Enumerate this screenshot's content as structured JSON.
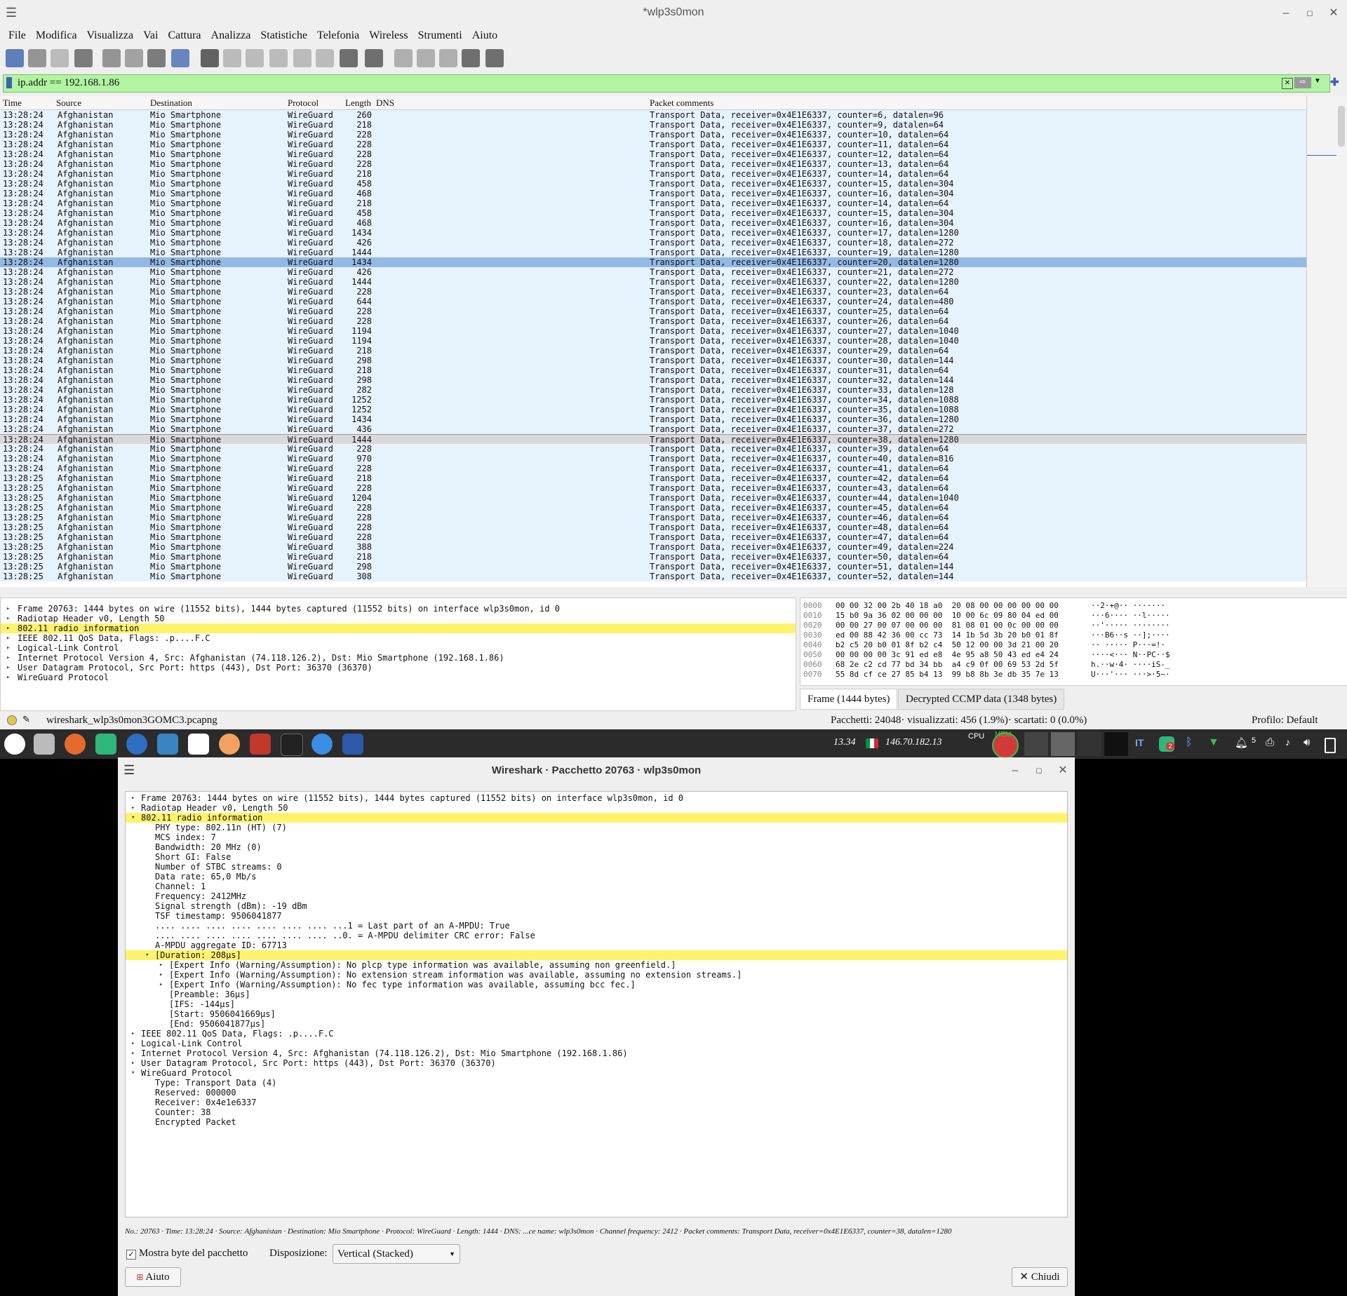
{
  "window": {
    "title": "*wlp3s0mon"
  },
  "menu": [
    "File",
    "Modifica",
    "Visualizza",
    "Vai",
    "Cattura",
    "Analizza",
    "Statistiche",
    "Telefonia",
    "Wireless",
    "Strumenti",
    "Aiuto"
  ],
  "filter": {
    "value": "ip.addr == 192.168.1.86"
  },
  "columns": {
    "time": "Time",
    "source": "Source",
    "destination": "Destination",
    "protocol": "Protocol",
    "length": "Length",
    "dns": "DNS",
    "comments": "Packet comments"
  },
  "packets": [
    {
      "t": "13:28:24",
      "src": "Afghanistan",
      "dst": "Mio Smartphone",
      "proto": "WireGuard",
      "len": "260",
      "info": "Transport Data, receiver=0x4E1E6337, counter=6, datalen=96"
    },
    {
      "t": "13:28:24",
      "src": "Afghanistan",
      "dst": "Mio Smartphone",
      "proto": "WireGuard",
      "len": "218",
      "info": "Transport Data, receiver=0x4E1E6337, counter=9, datalen=64"
    },
    {
      "t": "13:28:24",
      "src": "Afghanistan",
      "dst": "Mio Smartphone",
      "proto": "WireGuard",
      "len": "228",
      "info": "Transport Data, receiver=0x4E1E6337, counter=10, datalen=64"
    },
    {
      "t": "13:28:24",
      "src": "Afghanistan",
      "dst": "Mio Smartphone",
      "proto": "WireGuard",
      "len": "228",
      "info": "Transport Data, receiver=0x4E1E6337, counter=11, datalen=64"
    },
    {
      "t": "13:28:24",
      "src": "Afghanistan",
      "dst": "Mio Smartphone",
      "proto": "WireGuard",
      "len": "228",
      "info": "Transport Data, receiver=0x4E1E6337, counter=12, datalen=64"
    },
    {
      "t": "13:28:24",
      "src": "Afghanistan",
      "dst": "Mio Smartphone",
      "proto": "WireGuard",
      "len": "228",
      "info": "Transport Data, receiver=0x4E1E6337, counter=13, datalen=64"
    },
    {
      "t": "13:28:24",
      "src": "Afghanistan",
      "dst": "Mio Smartphone",
      "proto": "WireGuard",
      "len": "218",
      "info": "Transport Data, receiver=0x4E1E6337, counter=14, datalen=64"
    },
    {
      "t": "13:28:24",
      "src": "Afghanistan",
      "dst": "Mio Smartphone",
      "proto": "WireGuard",
      "len": "458",
      "info": "Transport Data, receiver=0x4E1E6337, counter=15, datalen=304"
    },
    {
      "t": "13:28:24",
      "src": "Afghanistan",
      "dst": "Mio Smartphone",
      "proto": "WireGuard",
      "len": "468",
      "info": "Transport Data, receiver=0x4E1E6337, counter=16, datalen=304"
    },
    {
      "t": "13:28:24",
      "src": "Afghanistan",
      "dst": "Mio Smartphone",
      "proto": "WireGuard",
      "len": "218",
      "info": "Transport Data, receiver=0x4E1E6337, counter=14, datalen=64"
    },
    {
      "t": "13:28:24",
      "src": "Afghanistan",
      "dst": "Mio Smartphone",
      "proto": "WireGuard",
      "len": "458",
      "info": "Transport Data, receiver=0x4E1E6337, counter=15, datalen=304"
    },
    {
      "t": "13:28:24",
      "src": "Afghanistan",
      "dst": "Mio Smartphone",
      "proto": "WireGuard",
      "len": "468",
      "info": "Transport Data, receiver=0x4E1E6337, counter=16, datalen=304"
    },
    {
      "t": "13:28:24",
      "src": "Afghanistan",
      "dst": "Mio Smartphone",
      "proto": "WireGuard",
      "len": "1434",
      "info": "Transport Data, receiver=0x4E1E6337, counter=17, datalen=1280"
    },
    {
      "t": "13:28:24",
      "src": "Afghanistan",
      "dst": "Mio Smartphone",
      "proto": "WireGuard",
      "len": "426",
      "info": "Transport Data, receiver=0x4E1E6337, counter=18, datalen=272"
    },
    {
      "t": "13:28:24",
      "src": "Afghanistan",
      "dst": "Mio Smartphone",
      "proto": "WireGuard",
      "len": "1444",
      "info": "Transport Data, receiver=0x4E1E6337, counter=19, datalen=1280"
    },
    {
      "t": "13:28:24",
      "src": "Afghanistan",
      "dst": "Mio Smartphone",
      "proto": "WireGuard",
      "len": "1434",
      "info": "Transport Data, receiver=0x4E1E6337, counter=20, datalen=1280",
      "state": "sel"
    },
    {
      "t": "13:28:24",
      "src": "Afghanistan",
      "dst": "Mio Smartphone",
      "proto": "WireGuard",
      "len": "426",
      "info": "Transport Data, receiver=0x4E1E6337, counter=21, datalen=272"
    },
    {
      "t": "13:28:24",
      "src": "Afghanistan",
      "dst": "Mio Smartphone",
      "proto": "WireGuard",
      "len": "1444",
      "info": "Transport Data, receiver=0x4E1E6337, counter=22, datalen=1280"
    },
    {
      "t": "13:28:24",
      "src": "Afghanistan",
      "dst": "Mio Smartphone",
      "proto": "WireGuard",
      "len": "228",
      "info": "Transport Data, receiver=0x4E1E6337, counter=23, datalen=64"
    },
    {
      "t": "13:28:24",
      "src": "Afghanistan",
      "dst": "Mio Smartphone",
      "proto": "WireGuard",
      "len": "644",
      "info": "Transport Data, receiver=0x4E1E6337, counter=24, datalen=480"
    },
    {
      "t": "13:28:24",
      "src": "Afghanistan",
      "dst": "Mio Smartphone",
      "proto": "WireGuard",
      "len": "228",
      "info": "Transport Data, receiver=0x4E1E6337, counter=25, datalen=64"
    },
    {
      "t": "13:28:24",
      "src": "Afghanistan",
      "dst": "Mio Smartphone",
      "proto": "WireGuard",
      "len": "228",
      "info": "Transport Data, receiver=0x4E1E6337, counter=26, datalen=64"
    },
    {
      "t": "13:28:24",
      "src": "Afghanistan",
      "dst": "Mio Smartphone",
      "proto": "WireGuard",
      "len": "1194",
      "info": "Transport Data, receiver=0x4E1E6337, counter=27, datalen=1040"
    },
    {
      "t": "13:28:24",
      "src": "Afghanistan",
      "dst": "Mio Smartphone",
      "proto": "WireGuard",
      "len": "1194",
      "info": "Transport Data, receiver=0x4E1E6337, counter=28, datalen=1040"
    },
    {
      "t": "13:28:24",
      "src": "Afghanistan",
      "dst": "Mio Smartphone",
      "proto": "WireGuard",
      "len": "218",
      "info": "Transport Data, receiver=0x4E1E6337, counter=29, datalen=64"
    },
    {
      "t": "13:28:24",
      "src": "Afghanistan",
      "dst": "Mio Smartphone",
      "proto": "WireGuard",
      "len": "298",
      "info": "Transport Data, receiver=0x4E1E6337, counter=30, datalen=144"
    },
    {
      "t": "13:28:24",
      "src": "Afghanistan",
      "dst": "Mio Smartphone",
      "proto": "WireGuard",
      "len": "218",
      "info": "Transport Data, receiver=0x4E1E6337, counter=31, datalen=64"
    },
    {
      "t": "13:28:24",
      "src": "Afghanistan",
      "dst": "Mio Smartphone",
      "proto": "WireGuard",
      "len": "298",
      "info": "Transport Data, receiver=0x4E1E6337, counter=32, datalen=144"
    },
    {
      "t": "13:28:24",
      "src": "Afghanistan",
      "dst": "Mio Smartphone",
      "proto": "WireGuard",
      "len": "282",
      "info": "Transport Data, receiver=0x4E1E6337, counter=33, datalen=128"
    },
    {
      "t": "13:28:24",
      "src": "Afghanistan",
      "dst": "Mio Smartphone",
      "proto": "WireGuard",
      "len": "1252",
      "info": "Transport Data, receiver=0x4E1E6337, counter=34, datalen=1088"
    },
    {
      "t": "13:28:24",
      "src": "Afghanistan",
      "dst": "Mio Smartphone",
      "proto": "WireGuard",
      "len": "1252",
      "info": "Transport Data, receiver=0x4E1E6337, counter=35, datalen=1088"
    },
    {
      "t": "13:28:24",
      "src": "Afghanistan",
      "dst": "Mio Smartphone",
      "proto": "WireGuard",
      "len": "1434",
      "info": "Transport Data, receiver=0x4E1E6337, counter=36, datalen=1280"
    },
    {
      "t": "13:28:24",
      "src": "Afghanistan",
      "dst": "Mio Smartphone",
      "proto": "WireGuard",
      "len": "436",
      "info": "Transport Data, receiver=0x4E1E6337, counter=37, datalen=272"
    },
    {
      "t": "13:28:24",
      "src": "Afghanistan",
      "dst": "Mio Smartphone",
      "proto": "WireGuard",
      "len": "1444",
      "info": "Transport Data, receiver=0x4E1E6337, counter=38, datalen=1280",
      "state": "mark"
    },
    {
      "t": "13:28:24",
      "src": "Afghanistan",
      "dst": "Mio Smartphone",
      "proto": "WireGuard",
      "len": "228",
      "info": "Transport Data, receiver=0x4E1E6337, counter=39, datalen=64"
    },
    {
      "t": "13:28:24",
      "src": "Afghanistan",
      "dst": "Mio Smartphone",
      "proto": "WireGuard",
      "len": "970",
      "info": "Transport Data, receiver=0x4E1E6337, counter=40, datalen=816"
    },
    {
      "t": "13:28:24",
      "src": "Afghanistan",
      "dst": "Mio Smartphone",
      "proto": "WireGuard",
      "len": "228",
      "info": "Transport Data, receiver=0x4E1E6337, counter=41, datalen=64"
    },
    {
      "t": "13:28:25",
      "src": "Afghanistan",
      "dst": "Mio Smartphone",
      "proto": "WireGuard",
      "len": "218",
      "info": "Transport Data, receiver=0x4E1E6337, counter=42, datalen=64"
    },
    {
      "t": "13:28:25",
      "src": "Afghanistan",
      "dst": "Mio Smartphone",
      "proto": "WireGuard",
      "len": "228",
      "info": "Transport Data, receiver=0x4E1E6337, counter=43, datalen=64"
    },
    {
      "t": "13:28:25",
      "src": "Afghanistan",
      "dst": "Mio Smartphone",
      "proto": "WireGuard",
      "len": "1204",
      "info": "Transport Data, receiver=0x4E1E6337, counter=44, datalen=1040"
    },
    {
      "t": "13:28:25",
      "src": "Afghanistan",
      "dst": "Mio Smartphone",
      "proto": "WireGuard",
      "len": "228",
      "info": "Transport Data, receiver=0x4E1E6337, counter=45, datalen=64"
    },
    {
      "t": "13:28:25",
      "src": "Afghanistan",
      "dst": "Mio Smartphone",
      "proto": "WireGuard",
      "len": "228",
      "info": "Transport Data, receiver=0x4E1E6337, counter=46, datalen=64"
    },
    {
      "t": "13:28:25",
      "src": "Afghanistan",
      "dst": "Mio Smartphone",
      "proto": "WireGuard",
      "len": "228",
      "info": "Transport Data, receiver=0x4E1E6337, counter=48, datalen=64"
    },
    {
      "t": "13:28:25",
      "src": "Afghanistan",
      "dst": "Mio Smartphone",
      "proto": "WireGuard",
      "len": "228",
      "info": "Transport Data, receiver=0x4E1E6337, counter=47, datalen=64"
    },
    {
      "t": "13:28:25",
      "src": "Afghanistan",
      "dst": "Mio Smartphone",
      "proto": "WireGuard",
      "len": "388",
      "info": "Transport Data, receiver=0x4E1E6337, counter=49, datalen=224"
    },
    {
      "t": "13:28:25",
      "src": "Afghanistan",
      "dst": "Mio Smartphone",
      "proto": "WireGuard",
      "len": "218",
      "info": "Transport Data, receiver=0x4E1E6337, counter=50, datalen=64"
    },
    {
      "t": "13:28:25",
      "src": "Afghanistan",
      "dst": "Mio Smartphone",
      "proto": "WireGuard",
      "len": "298",
      "info": "Transport Data, receiver=0x4E1E6337, counter=51, datalen=144"
    },
    {
      "t": "13:28:25",
      "src": "Afghanistan",
      "dst": "Mio Smartphone",
      "proto": "WireGuard",
      "len": "308",
      "info": "Transport Data, receiver=0x4E1E6337, counter=52, datalen=144"
    }
  ],
  "details": [
    {
      "text": "Frame 20763: 1444 bytes on wire (11552 bits), 1444 bytes captured (11552 bits) on interface wlp3s0mon, id 0"
    },
    {
      "text": "Radiotap Header v0, Length 50"
    },
    {
      "text": "802.11 radio information",
      "hl": true
    },
    {
      "text": "IEEE 802.11 QoS Data, Flags: .p....F.C"
    },
    {
      "text": "Logical-Link Control"
    },
    {
      "text": "Internet Protocol Version 4, Src: Afghanistan (74.118.126.2), Dst: Mio Smartphone (192.168.1.86)"
    },
    {
      "text": "User Datagram Protocol, Src Port: https (443), Dst Port: 36370 (36370)"
    },
    {
      "text": "WireGuard Protocol"
    }
  ],
  "hex": [
    {
      "off": "0000",
      "bytes": "00 00 32 00 2b 40 18 a0  20 08 00 00 00 00 00 00",
      "ascii": "··2·+@·· ·······"
    },
    {
      "off": "0010",
      "bytes": "15 b0 9a 36 02 00 00 00  10 00 6c 09 80 04 ed 00",
      "ascii": "···6···· ··l·····"
    },
    {
      "off": "0020",
      "bytes": "00 00 27 00 07 00 00 00  81 08 01 00 0c 00 00 00",
      "ascii": "··'····· ········"
    },
    {
      "off": "0030",
      "bytes": "ed 00 88 42 36 00 cc 73  14 1b 5d 3b 20 b0 01 8f",
      "ascii": "···B6··s ··];····"
    },
    {
      "off": "0040",
      "bytes": "b2 c5 20 b0 01 8f b2 c4  50 12 00 00 3d 21 00 20",
      "ascii": "·· ····· P···=!· "
    },
    {
      "off": "0050",
      "bytes": "00 00 00 00 3c 91 ed e8  4e 95 a8 50 43 ed e4 24",
      "ascii": "····<··· N··PC··$"
    },
    {
      "off": "0060",
      "bytes": "68 2e c2 cd 77 bd 34 bb  a4 c9 0f 00 69 53 2d 5f",
      "ascii": "h.··w·4· ····iS-_"
    },
    {
      "off": "0070",
      "bytes": "55 8d cf ce 27 85 b4 13  99 b8 8b 3e db 35 7e 13",
      "ascii": "U···'··· ···>·5~·"
    }
  ],
  "bytetabs": [
    "Frame (1444 bytes)",
    "Decrypted CCMP data (1348 bytes)"
  ],
  "status": {
    "file": "wireshark_wlp3s0mon3GOMC3.pcapng",
    "counts": "Pacchetti: 24048· visualizzati: 456 (1.9%)· scartati: 0 (0.0%)",
    "profile": "Profilo: Default"
  },
  "taskbar": {
    "time": "13.34",
    "ip": "146.70.182.13",
    "cpu": "CPU",
    "mem": "MEM",
    "lang": "IT",
    "badge": "2",
    "notif": "5"
  },
  "dialog": {
    "title": "Wireshark · Pacchetto 20763 · wlp3s0mon",
    "tree": [
      {
        "indent": 0,
        "arrow": "right",
        "text": "Frame 20763: 1444 bytes on wire (11552 bits), 1444 bytes captured (11552 bits) on interface wlp3s0mon, id 0"
      },
      {
        "indent": 0,
        "arrow": "right",
        "text": "Radiotap Header v0, Length 50"
      },
      {
        "indent": 0,
        "arrow": "down",
        "text": "802.11 radio information",
        "hl": true
      },
      {
        "indent": 1,
        "text": "PHY type: 802.11n (HT) (7)"
      },
      {
        "indent": 1,
        "text": "MCS index: 7"
      },
      {
        "indent": 1,
        "text": "Bandwidth: 20 MHz (0)"
      },
      {
        "indent": 1,
        "text": "Short GI: False"
      },
      {
        "indent": 1,
        "text": "Number of STBC streams: 0"
      },
      {
        "indent": 1,
        "text": "Data rate: 65,0 Mb/s"
      },
      {
        "indent": 1,
        "text": "Channel: 1"
      },
      {
        "indent": 1,
        "text": "Frequency: 2412MHz"
      },
      {
        "indent": 1,
        "text": "Signal strength (dBm): -19 dBm"
      },
      {
        "indent": 1,
        "text": "TSF timestamp: 9506041877"
      },
      {
        "indent": 1,
        "text": ".... .... .... .... .... .... .... ...1 = Last part of an A-MPDU: True"
      },
      {
        "indent": 1,
        "text": ".... .... .... .... .... .... .... ..0. = A-MPDU delimiter CRC error: False"
      },
      {
        "indent": 1,
        "text": "A-MPDU aggregate ID: 67713"
      },
      {
        "indent": 1,
        "arrow": "down",
        "text": "[Duration: 208µs]",
        "hl": true
      },
      {
        "indent": 2,
        "arrow": "right",
        "text": "[Expert Info (Warning/Assumption): No plcp type information was available, assuming non greenfield.]"
      },
      {
        "indent": 2,
        "arrow": "right",
        "text": "[Expert Info (Warning/Assumption): No extension stream information was available, assuming no extension streams.]"
      },
      {
        "indent": 2,
        "arrow": "right",
        "text": "[Expert Info (Warning/Assumption): No fec type information was available, assuming bcc fec.]"
      },
      {
        "indent": 2,
        "text": "[Preamble: 36µs]"
      },
      {
        "indent": 2,
        "text": "[IFS: -144µs]"
      },
      {
        "indent": 2,
        "text": "[Start: 9506041669µs]"
      },
      {
        "indent": 2,
        "text": "[End: 9506041877µs]"
      },
      {
        "indent": 0,
        "arrow": "right",
        "text": "IEEE 802.11 QoS Data, Flags: .p....F.C"
      },
      {
        "indent": 0,
        "arrow": "right",
        "text": "Logical-Link Control"
      },
      {
        "indent": 0,
        "arrow": "right",
        "text": "Internet Protocol Version 4, Src: Afghanistan (74.118.126.2), Dst: Mio Smartphone (192.168.1.86)"
      },
      {
        "indent": 0,
        "arrow": "right",
        "text": "User Datagram Protocol, Src Port: https (443), Dst Port: 36370 (36370)"
      },
      {
        "indent": 0,
        "arrow": "down",
        "text": "WireGuard Protocol"
      },
      {
        "indent": 1,
        "text": "Type: Transport Data (4)"
      },
      {
        "indent": 1,
        "text": "Reserved: 000000"
      },
      {
        "indent": 1,
        "text": "Receiver: 0x4e1e6337"
      },
      {
        "indent": 1,
        "text": "Counter: 38"
      },
      {
        "indent": 1,
        "text": "Encrypted Packet"
      }
    ],
    "info": "No.: 20763 · Time: 13:28:24 · Source: Afghanistan · Destination: Mio Smartphone · Protocol: WireGuard · Length: 1444 · DNS: ...ce name: wlp3s0mon · Channel frequency: 2412 · Packet comments: Transport Data, receiver=0x4E1E6337, counter=38, datalen=1280",
    "show_bytes_label": "Mostra byte del pacchetto",
    "layout_label": "Disposizione:",
    "layout_value": "Vertical (Stacked)",
    "help_label": "Aiuto",
    "close_label": "Chiudi"
  },
  "colors": {
    "row": "#e6f2fc",
    "selected": "#93b9e6",
    "highlight": "#fff36b",
    "filter_ok": "#b1f4a2"
  }
}
